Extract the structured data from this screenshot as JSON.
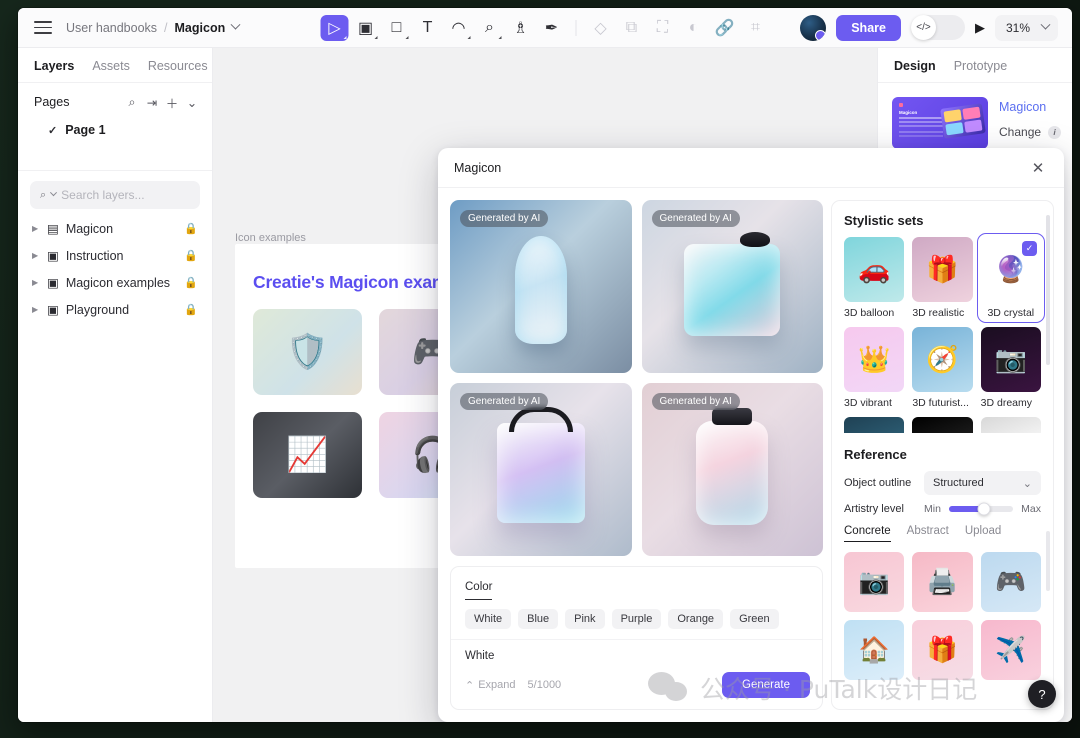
{
  "header": {
    "menu_icon": "hamburger-icon",
    "breadcrumb_root": "User handbooks",
    "breadcrumb_separator": "/",
    "breadcrumb_current": "Magicon",
    "share_label": "Share",
    "code_icon": "</>",
    "play_icon": "▶",
    "zoom_level": "31%"
  },
  "toolbar": {
    "tools": [
      {
        "name": "move-tool",
        "glyph": "▷",
        "active": true,
        "dim": false
      },
      {
        "name": "frame-tool",
        "glyph": "▣",
        "active": false,
        "dim": false
      },
      {
        "name": "rectangle-tool",
        "glyph": "□",
        "active": false,
        "dim": false
      },
      {
        "name": "text-tool",
        "glyph": "T",
        "active": false,
        "dim": false
      },
      {
        "name": "pen-tool",
        "glyph": "⌢",
        "active": false,
        "dim": false
      },
      {
        "name": "magic-search-tool",
        "glyph": "⌕",
        "active": false,
        "dim": false
      },
      {
        "name": "ai-magic-tool",
        "glyph": "♟",
        "active": false,
        "dim": false
      },
      {
        "name": "brush-tool",
        "glyph": "✐",
        "active": false,
        "dim": false
      }
    ],
    "disabled_tools": [
      {
        "name": "component-icon",
        "glyph": "◇"
      },
      {
        "name": "duplicate-icon",
        "glyph": "⧉"
      },
      {
        "name": "transform-icon",
        "glyph": "⛶"
      },
      {
        "name": "mask-icon",
        "glyph": "◐"
      },
      {
        "name": "link-icon",
        "glyph": "🔗"
      },
      {
        "name": "crop-icon",
        "glyph": "⌘"
      }
    ]
  },
  "left_panel": {
    "tabs": [
      {
        "label": "Layers",
        "active": true
      },
      {
        "label": "Assets",
        "active": false
      },
      {
        "label": "Resources",
        "active": false
      }
    ],
    "pages_title": "Pages",
    "pages_actions": [
      "search-icon",
      "sort-icon",
      "plus-icon",
      "chevron-down-icon"
    ],
    "pages": [
      {
        "label": "Page 1",
        "selected": true
      }
    ],
    "search_placeholder": "Search layers...",
    "layers": [
      {
        "label": "Magicon",
        "locked": true
      },
      {
        "label": "Instruction",
        "locked": true
      },
      {
        "label": "Magicon examples",
        "locked": true
      },
      {
        "label": "Playground",
        "locked": true
      }
    ]
  },
  "canvas": {
    "frame_label": "Icon examples",
    "artboard_title": "Creatie's Magicon examples",
    "icons": [
      {
        "name": "shield-check-icon",
        "glyph": "🛡️"
      },
      {
        "name": "gamepad-icon",
        "glyph": "🎮"
      },
      {
        "name": "chart-growth-icon",
        "glyph": "📈"
      },
      {
        "name": "headphones-icon",
        "glyph": "🎧"
      }
    ]
  },
  "right_panel": {
    "tabs": [
      {
        "label": "Design",
        "active": true
      },
      {
        "label": "Prototype",
        "active": false
      }
    ],
    "plugin_name": "Magicon",
    "plugin_thumb_title": "Magicon",
    "change_label": "Change",
    "info_icon": "i"
  },
  "modal": {
    "title": "Magicon",
    "close_icon": "✕",
    "generated": [
      {
        "name": "generated-image-1",
        "badge": "Generated by AI",
        "shape": "vase"
      },
      {
        "name": "generated-image-2",
        "badge": "Generated by AI",
        "shape": "cube"
      },
      {
        "name": "generated-image-3",
        "badge": "Generated by AI",
        "shape": "lantern"
      },
      {
        "name": "generated-image-4",
        "badge": "Generated by AI",
        "shape": "bottle"
      }
    ],
    "prompt": {
      "tab_label": "Color",
      "chips": [
        "White",
        "Blue",
        "Pink",
        "Purple",
        "Orange",
        "Green"
      ],
      "value": "White",
      "expand_label": "Expand",
      "counter": "5/1000",
      "generate_label": "Generate"
    },
    "stylistic": {
      "title": "Stylistic sets",
      "items": [
        {
          "label": "3D balloon",
          "glyph": "🚗",
          "selected": false
        },
        {
          "label": "3D realistic",
          "glyph": "🎁",
          "selected": false
        },
        {
          "label": "3D crystal",
          "glyph": "🔮",
          "selected": true
        },
        {
          "label": "3D vibrant",
          "glyph": "👑",
          "selected": false
        },
        {
          "label": "3D futurist...",
          "glyph": "🧭",
          "selected": false
        },
        {
          "label": "3D dreamy",
          "glyph": "📷",
          "selected": false
        }
      ]
    },
    "reference": {
      "title": "Reference",
      "outline_label": "Object outline",
      "outline_value": "Structured",
      "artistry_label": "Artistry level",
      "artistry_min": "Min",
      "artistry_max": "Max",
      "artistry_percent": 55,
      "tabs": [
        {
          "label": "Concrete",
          "active": true
        },
        {
          "label": "Abstract",
          "active": false
        },
        {
          "label": "Upload",
          "active": false
        }
      ],
      "images": [
        {
          "name": "reference-camera",
          "glyph": "📷"
        },
        {
          "name": "reference-printer",
          "glyph": "🖨️"
        },
        {
          "name": "reference-gamepad",
          "glyph": "🎮"
        },
        {
          "name": "reference-house",
          "glyph": "🏠"
        },
        {
          "name": "reference-gift",
          "glyph": "🎁"
        },
        {
          "name": "reference-airplane",
          "glyph": "✈️"
        }
      ]
    }
  },
  "watermark": {
    "text": "公众号 · PuTalk设计日记"
  },
  "help": {
    "label": "?"
  },
  "colors": {
    "accent": "#6c5cf0",
    "link": "#5b6ff0",
    "canvas_bg": "#f1f1f2"
  }
}
